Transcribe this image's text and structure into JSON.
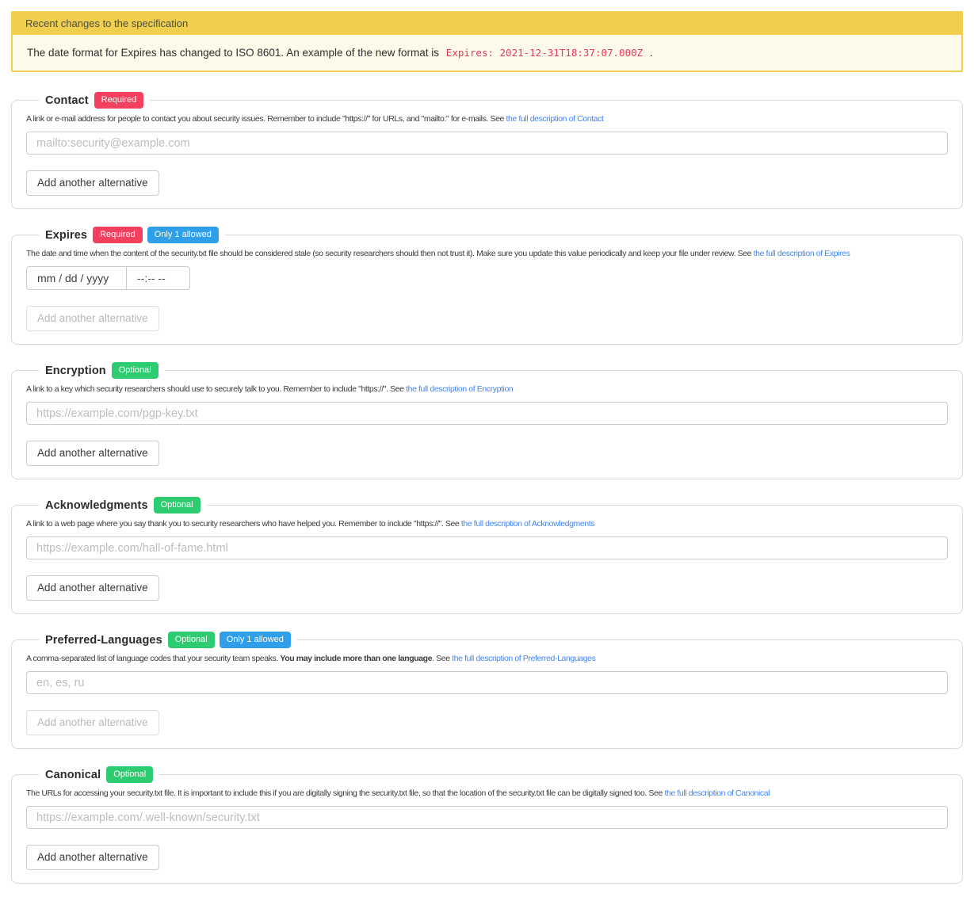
{
  "colors": {
    "banner_gold": "#F0CF4E",
    "banner_cream": "#FDFAE9",
    "badge_required": "#F3405E",
    "badge_optional": "#2ECC71",
    "badge_limit": "#2E9FE8",
    "link_blue": "#4285F4",
    "code_pink": "#E8395E"
  },
  "banner": {
    "title": "Recent changes to the specification",
    "message_prefix": "The date format for Expires has changed to ISO 8601. An example of the new format is ",
    "code_example": "Expires: 2021-12-31T18:37:07.000Z",
    "message_suffix": " ."
  },
  "sections": [
    {
      "id": "contact",
      "title": "Contact",
      "badges": [
        {
          "label": "Required",
          "type": "required"
        }
      ],
      "desc_pre": "A link or e-mail address for people to contact you about security issues. Remember to include \"https://\" for URLs, and \"mailto:\" for e-mails. See ",
      "link_text": "the full description of Contact",
      "input": {
        "kind": "text",
        "placeholder": "mailto:security@example.com"
      },
      "button_label": "Add another alternative",
      "button_disabled": false
    },
    {
      "id": "expires",
      "title": "Expires",
      "badges": [
        {
          "label": "Required",
          "type": "required"
        },
        {
          "label": "Only 1 allowed",
          "type": "limit"
        }
      ],
      "desc_pre": "The date and time when the content of the security.txt file should be considered stale (so security researchers should then not trust it). Make sure you update this value periodically and keep your file under review. See ",
      "link_text": "the full description of Expires",
      "input": {
        "kind": "datetime",
        "date_text": "mm / dd / yyyy",
        "time_text": "--:-- --"
      },
      "button_label": "Add another alternative",
      "button_disabled": true
    },
    {
      "id": "encryption",
      "title": "Encryption",
      "badges": [
        {
          "label": "Optional",
          "type": "optional"
        }
      ],
      "desc_pre": "A link to a key which security researchers should use to securely talk to you. Remember to include \"https://\". See ",
      "link_text": "the full description of Encryption",
      "input": {
        "kind": "text",
        "placeholder": "https://example.com/pgp-key.txt"
      },
      "button_label": "Add another alternative",
      "button_disabled": false
    },
    {
      "id": "acknowledgments",
      "title": "Acknowledgments",
      "badges": [
        {
          "label": "Optional",
          "type": "optional"
        }
      ],
      "desc_pre": "A link to a web page where you say thank you to security researchers who have helped you. Remember to include \"https://\". See ",
      "link_text": "the full description of Acknowledgments",
      "input": {
        "kind": "text",
        "placeholder": "https://example.com/hall-of-fame.html"
      },
      "button_label": "Add another alternative",
      "button_disabled": false
    },
    {
      "id": "preferred-languages",
      "title": "Preferred-Languages",
      "badges": [
        {
          "label": "Optional",
          "type": "optional"
        },
        {
          "label": "Only 1 allowed",
          "type": "limit"
        }
      ],
      "desc_pre": "A comma-separated list of language codes that your security team speaks. ",
      "desc_bold": "You may include more than one language",
      "desc_mid": ". See ",
      "link_text": "the full description of Preferred-Languages",
      "input": {
        "kind": "text",
        "placeholder": "en, es, ru"
      },
      "button_label": "Add another alternative",
      "button_disabled": true
    },
    {
      "id": "canonical",
      "title": "Canonical",
      "badges": [
        {
          "label": "Optional",
          "type": "optional"
        }
      ],
      "desc_pre": "The URLs for accessing your security.txt file. It is important to include this if you are digitally signing the security.txt file, so that the location of the security.txt file can be digitally signed too. See ",
      "link_text": "the full description of Canonical",
      "input": {
        "kind": "text",
        "placeholder": "https://example.com/.well-known/security.txt"
      },
      "button_label": "Add another alternative",
      "button_disabled": false
    }
  ]
}
